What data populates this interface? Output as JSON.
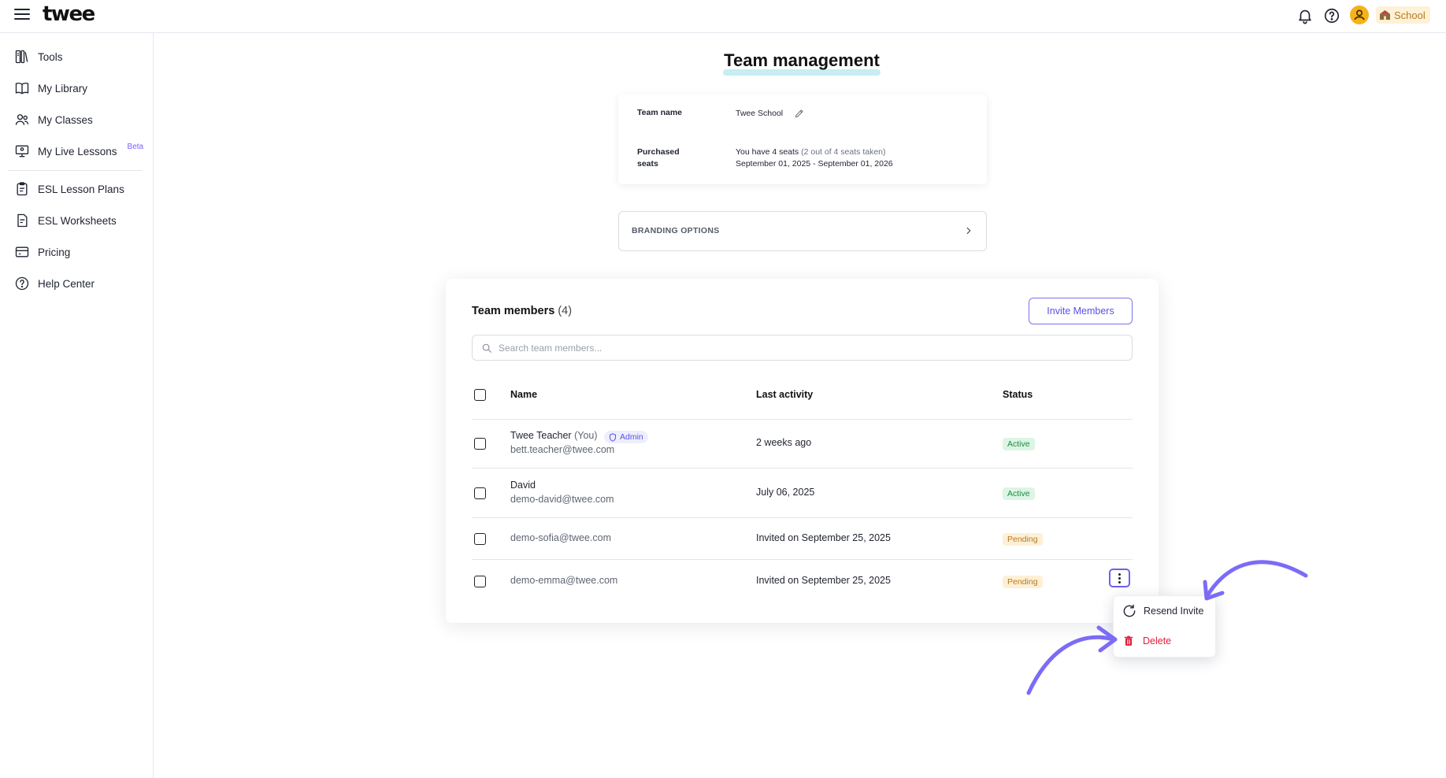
{
  "app": {
    "logo": "twee"
  },
  "header": {
    "school_label": "School"
  },
  "sidebar": {
    "items": [
      {
        "label": "Tools",
        "icon": "tools-icon"
      },
      {
        "label": "My Library",
        "icon": "book-icon"
      },
      {
        "label": "My Classes",
        "icon": "users-icon"
      },
      {
        "label": "My Live Lessons",
        "icon": "presentation-icon",
        "badge": "Beta"
      },
      {
        "label": "ESL Lesson Plans",
        "icon": "clipboard-icon"
      },
      {
        "label": "ESL Worksheets",
        "icon": "worksheet-icon"
      },
      {
        "label": "Pricing",
        "icon": "credit-card-icon"
      },
      {
        "label": "Help Center",
        "icon": "help-circle-icon"
      }
    ]
  },
  "page": {
    "title": "Team management"
  },
  "team_info": {
    "name_label": "Team name",
    "name_value": "Twee School",
    "seats_label_1": "Purchased",
    "seats_label_2": "seats",
    "seats_main": "You have 4 seats",
    "seats_taken": "(2 out of 4 seats taken)",
    "seats_period": "September 01, 2025 - September 01, 2026"
  },
  "branding": {
    "label": "BRANDING OPTIONS"
  },
  "members": {
    "title": "Team members",
    "count": "(4)",
    "invite_label": "Invite Members",
    "search_placeholder": "Search team members...",
    "columns": {
      "name": "Name",
      "activity": "Last activity",
      "status": "Status"
    },
    "rows": [
      {
        "name": "Twee Teacher",
        "you": "(You)",
        "role": "Admin",
        "email": "bett.teacher@twee.com",
        "activity": "2 weeks ago",
        "status": "Active"
      },
      {
        "name": "David",
        "email": "demo-david@twee.com",
        "activity": "July 06, 2025",
        "status": "Active"
      },
      {
        "email": "demo-sofia@twee.com",
        "activity": "Invited on September 25, 2025",
        "status": "Pending"
      },
      {
        "email": "demo-emma@twee.com",
        "activity": "Invited on September 25, 2025",
        "status": "Pending"
      }
    ]
  },
  "row_menu": {
    "resend": "Resend Invite",
    "delete": "Delete"
  },
  "colors": {
    "accent": "#6b60f5",
    "active": "#1e8a43",
    "pending": "#b7791f",
    "danger": "#e01e3c"
  }
}
